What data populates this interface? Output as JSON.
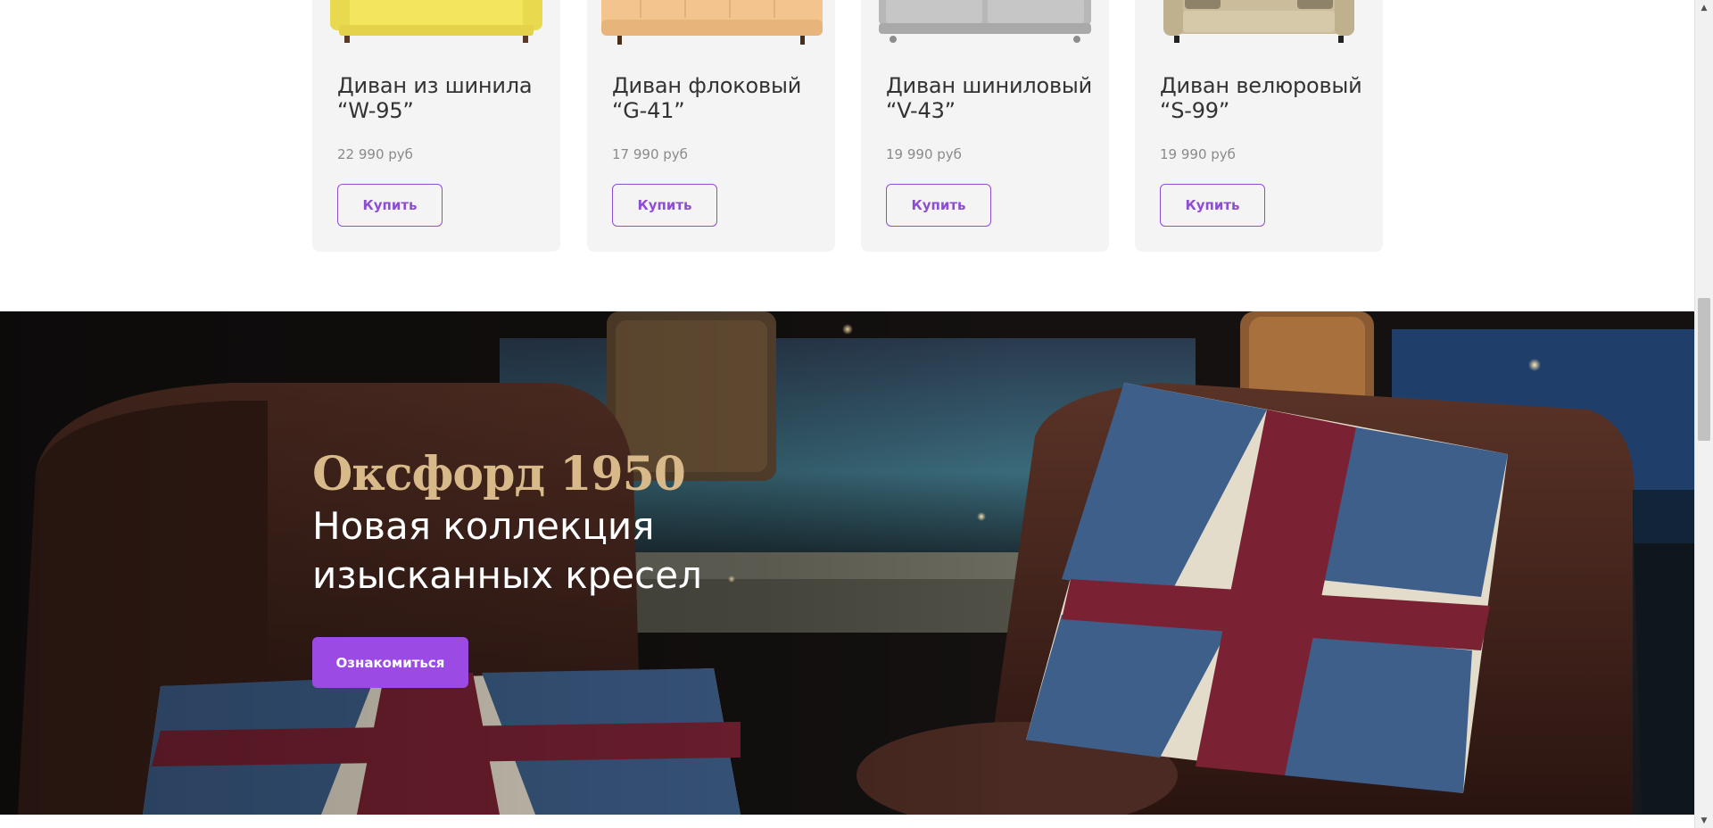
{
  "products": [
    {
      "title": "Диван из шинила “W-95”",
      "price": "22 990 руб",
      "buy_label": "Купить",
      "color": "#f3e86a"
    },
    {
      "title": "Диван флоковый “G-41”",
      "price": "17 990 руб",
      "buy_label": "Купить",
      "color": "#f2c48e"
    },
    {
      "title": "Диван шиниловый “V-43”",
      "price": "19 990 руб",
      "buy_label": "Купить",
      "color": "#b9b9b9"
    },
    {
      "title": "Диван велюровый “S-99”",
      "price": "19 990 руб",
      "buy_label": "Купить",
      "color": "#cdbf9f"
    }
  ],
  "banner": {
    "title": "Оксфорд 1950",
    "subtitle": "Новая коллекция изысканных кресел",
    "button_label": "Ознакомиться"
  },
  "colors": {
    "accent": "#9b4be4",
    "title_gold": "#d7b98a"
  },
  "scrollbar": {
    "up_icon": "chevron-up-icon",
    "down_icon": "chevron-down-icon"
  }
}
